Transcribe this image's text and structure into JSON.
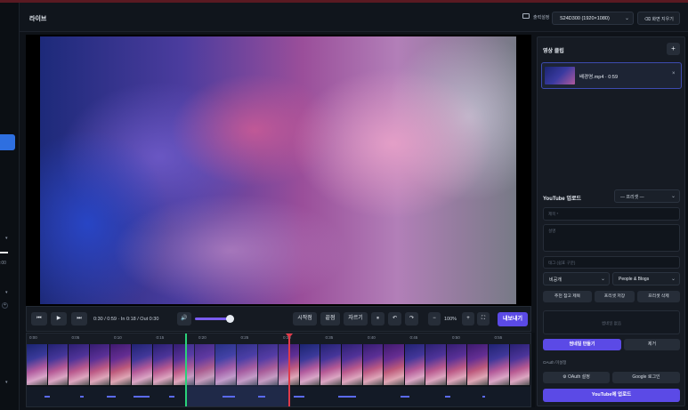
{
  "header": {
    "title": "라이브",
    "output_label": "출력설정",
    "resolution": "S24D300 (1920×1080)",
    "clear_button": "화면 지우기"
  },
  "left_strip": {
    "small_texts": [
      ":00"
    ],
    "plus_symbol": "+"
  },
  "transport": {
    "rewind": "⏮",
    "play": "▶",
    "forward": "⏭",
    "timecode": "0:30 / 0:59 · In 0:18 / Out 0:30",
    "volume_icon": "🔊",
    "volume_level": 0.8,
    "set_start": "시작점",
    "set_end": "끝점",
    "cut": "자르기",
    "pause_split": "⏸",
    "undo": "↶",
    "redo": "↷",
    "zoom_out": "−",
    "zoom": "100%",
    "zoom_in": "+",
    "fullscreen": "⛶",
    "export": "내보내기"
  },
  "timeline": {
    "ticks": [
      "0:00",
      "0:05",
      "0:10",
      "0:15",
      "0:20",
      "0:25",
      "0:30",
      "0:35",
      "0:40",
      "0:45",
      "0:50",
      "0:55"
    ],
    "in_point": "0:18",
    "out_point": "0:30",
    "playhead": "0:30"
  },
  "right_panel": {
    "clips_title": "영상 클립",
    "add": "+",
    "clip_name": "배경영.mp4 · 0:59",
    "clip_close": "×",
    "youtube_title": "YouTube 업로드",
    "preset_select": "— 프리셋 —",
    "title_placeholder": "제목 *",
    "description_placeholder": "설명",
    "tags_placeholder": "태그 (쉼표 구분)",
    "privacy": "비공개",
    "category": "People & Blogs",
    "recommend_title": "추천 참고 제목",
    "save_preset": "프리셋 저장",
    "delete_preset": "프리셋 삭제",
    "thumbnail_placeholder": "썸네일 없음",
    "make_thumbnail": "썸네일 만들기",
    "remove": "제거",
    "oauth_status": "OAuth 미설정",
    "oauth_settings": "⚙ OAuth 설정",
    "google_login": "Google 로그인",
    "upload": "YouTube에 업로드"
  }
}
